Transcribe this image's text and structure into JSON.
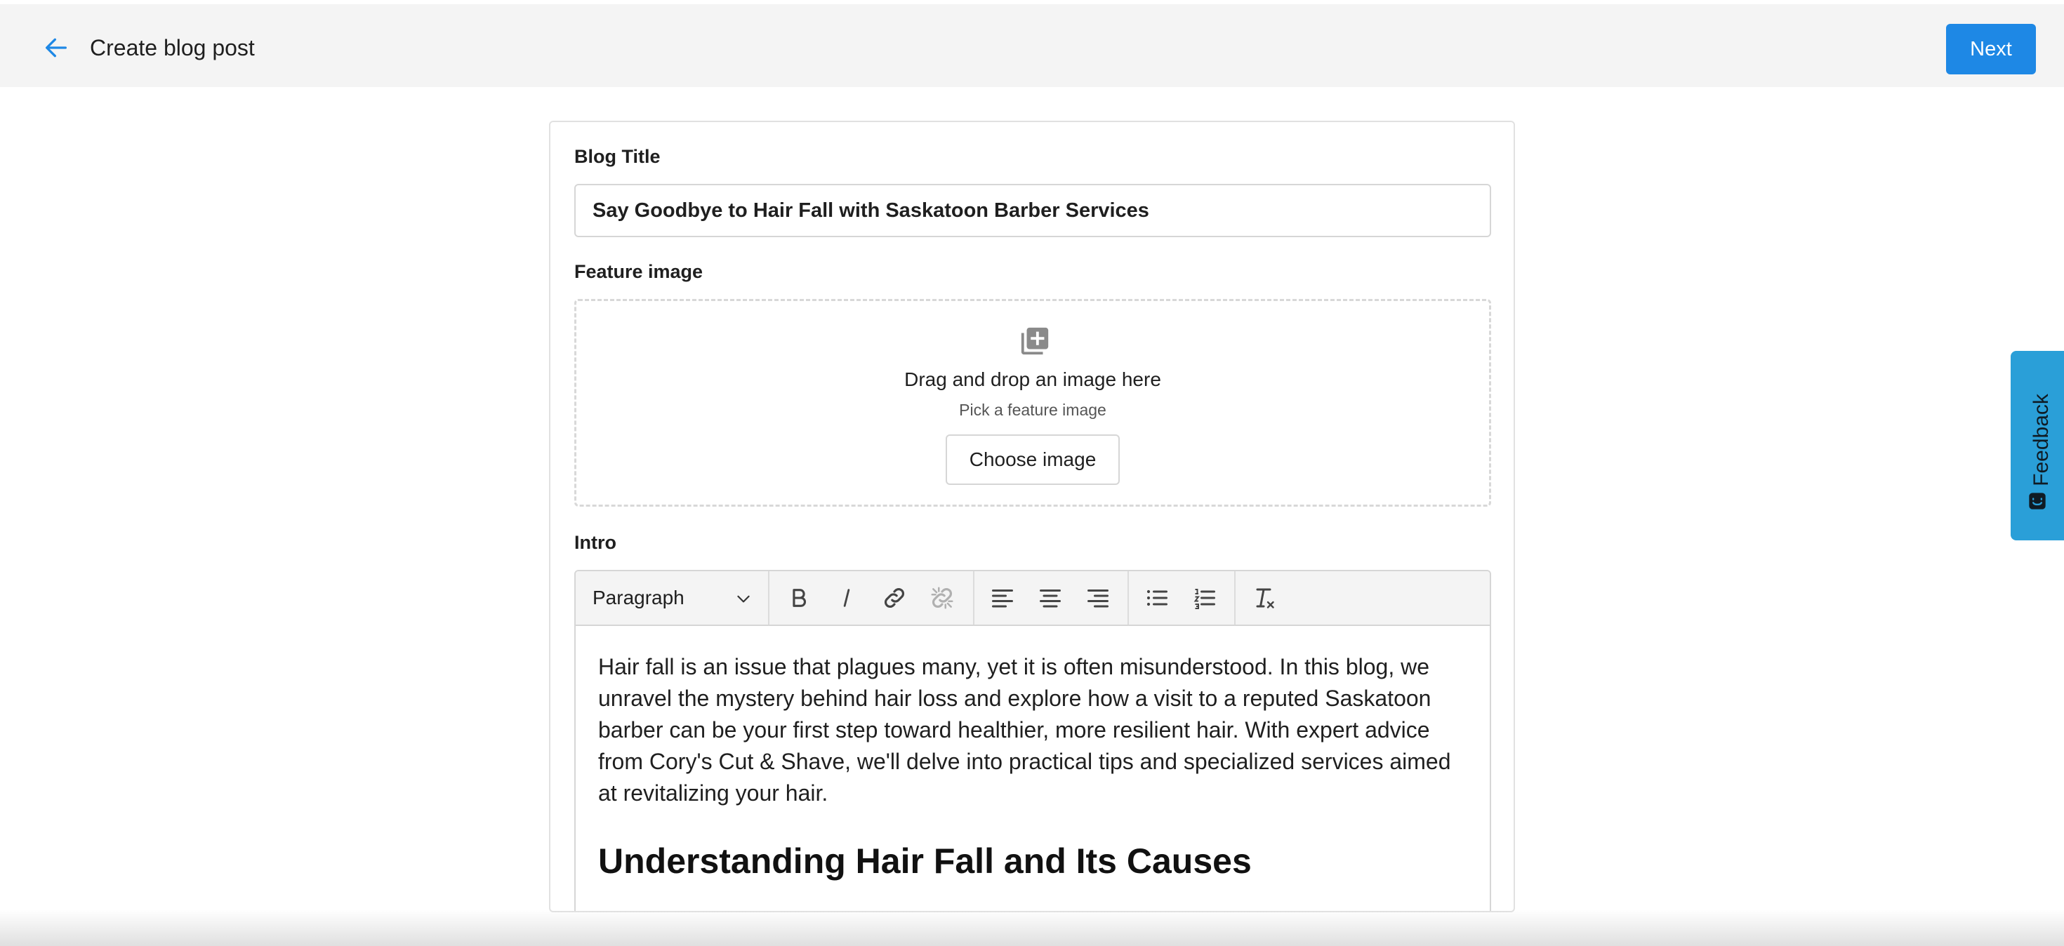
{
  "header": {
    "title": "Create blog post",
    "next_label": "Next"
  },
  "form": {
    "blog_title_label": "Blog Title",
    "blog_title_value": "Say Goodbye to Hair Fall with Saskatoon Barber Services",
    "feature_image_label": "Feature image",
    "dropzone_text": "Drag and drop an image here",
    "dropzone_sub": "Pick a feature image",
    "choose_image_label": "Choose image",
    "intro_label": "Intro"
  },
  "editor": {
    "block_format": "Paragraph",
    "toolbar_icons": [
      "bold-icon",
      "italic-icon",
      "link-icon",
      "unlink-icon",
      "align-left-icon",
      "align-center-icon",
      "align-right-icon",
      "bullet-list-icon",
      "numbered-list-icon",
      "clear-format-icon"
    ],
    "paragraph": "Hair fall is an issue that plagues many, yet it is often misunderstood. In this blog, we unravel the mystery behind hair loss and explore how a visit to a reputed Saskatoon barber can be your first step toward healthier, more resilient hair. With expert advice from Cory's Cut & Shave, we'll delve into practical tips and specialized services aimed at revitalizing your hair.",
    "heading": "Understanding Hair Fall and Its Causes"
  },
  "feedback": {
    "label": "Feedback"
  },
  "colors": {
    "primary": "#1e88e5",
    "feedback_tab": "#2a9fd8",
    "topbar_bg": "#f4f4f4"
  }
}
